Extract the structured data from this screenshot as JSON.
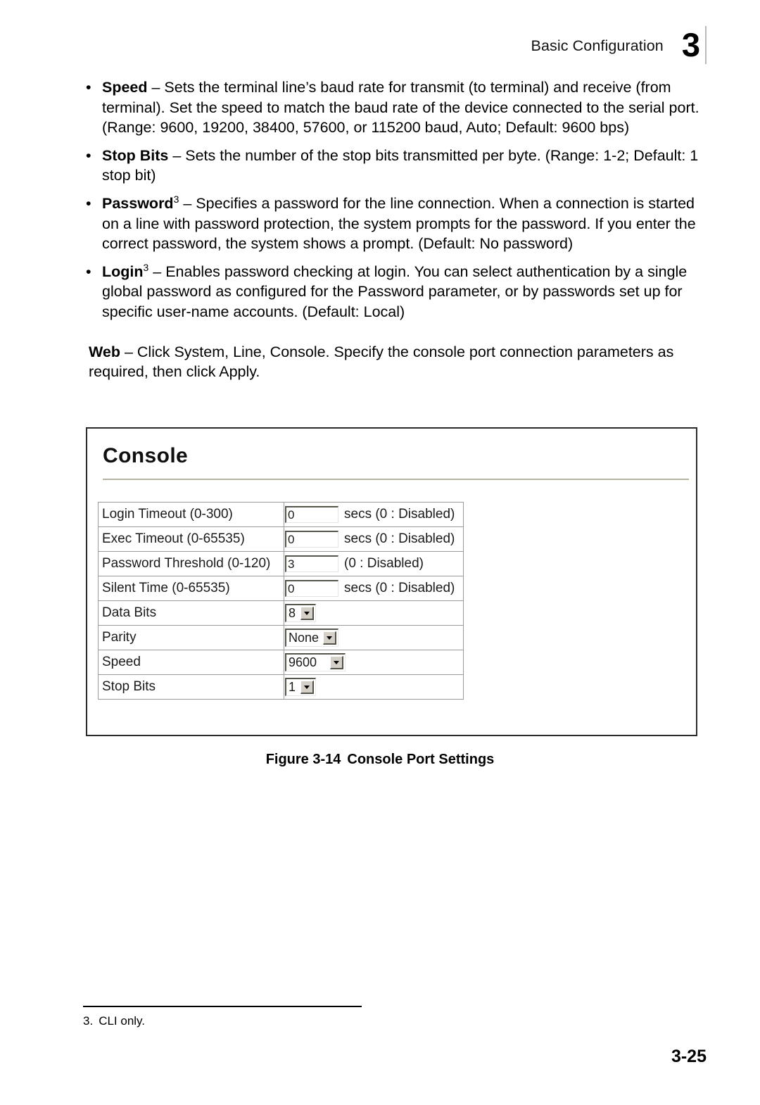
{
  "header": {
    "title": "Basic Configuration",
    "chapter": "3"
  },
  "bullets": [
    {
      "mark": "•",
      "term": "Speed",
      "sup": "",
      "body": " – Sets the terminal line’s baud rate for transmit (to terminal) and receive (from terminal). Set the speed to match the baud rate of the device connected to the serial port. (Range: 9600, 19200, 38400, 57600, or 115200 baud, Auto; Default: 9600 bps)"
    },
    {
      "mark": "•",
      "term": "Stop Bits",
      "sup": "",
      "body": " – Sets the number of the stop bits transmitted per byte. (Range: 1-2; Default: 1 stop bit)"
    },
    {
      "mark": "•",
      "term": "Password",
      "sup": "3",
      "body": " – Specifies a password for the line connection. When a connection is started on a line with password protection, the system prompts for the password. If you enter the correct password, the system shows a prompt. (Default: No password)"
    },
    {
      "mark": "•",
      "term": "Login",
      "sup": "3",
      "body": " – Enables password checking at login. You can select authentication by a single global password as configured for the Password parameter, or by passwords set up for specific user-name accounts. (Default: Local)"
    }
  ],
  "web_paragraph": {
    "term": "Web",
    "body": " – Click System, Line, Console. Specify the console port connection parameters as required, then click Apply."
  },
  "screenshot": {
    "title": "Console",
    "rows": [
      {
        "label": "Login Timeout (0-300)",
        "control": "text",
        "value": "0",
        "suffix": "secs (0 : Disabled)"
      },
      {
        "label": "Exec Timeout (0-65535)",
        "control": "text",
        "value": "0",
        "suffix": "secs (0 : Disabled)"
      },
      {
        "label": "Password Threshold (0-120)",
        "control": "text",
        "value": "3",
        "suffix": "(0 : Disabled)"
      },
      {
        "label": "Silent Time (0-65535)",
        "control": "text",
        "value": "0",
        "suffix": "secs (0 : Disabled)"
      },
      {
        "label": "Data Bits",
        "control": "select",
        "value": "8",
        "width": "narrow",
        "suffix": ""
      },
      {
        "label": "Parity",
        "control": "select",
        "value": "None",
        "width": "mid",
        "suffix": ""
      },
      {
        "label": "Speed",
        "control": "select",
        "value": "9600",
        "width": "wide",
        "suffix": ""
      },
      {
        "label": "Stop Bits",
        "control": "select",
        "value": "1",
        "width": "narrow",
        "suffix": ""
      }
    ]
  },
  "figure_caption": {
    "number": "Figure 3-14",
    "title": "Console Port Settings"
  },
  "footnote": {
    "number": "3.",
    "text": "CLI only."
  },
  "page_number": "3-25"
}
